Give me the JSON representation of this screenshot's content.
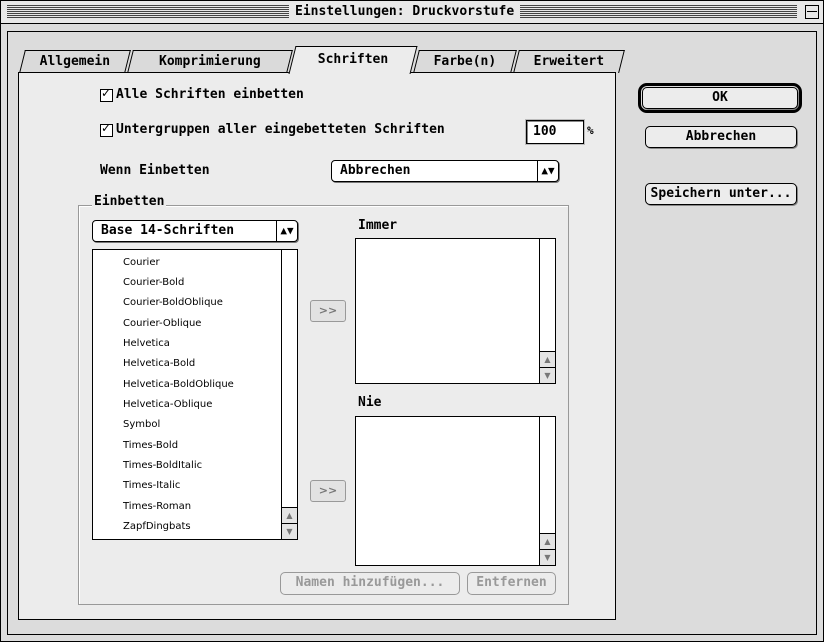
{
  "window": {
    "title": "Einstellungen: Druckvorstufe"
  },
  "tabs": [
    {
      "label": "Allgemein",
      "active": false
    },
    {
      "label": "Komprimierung",
      "active": false
    },
    {
      "label": "Schriften",
      "active": true
    },
    {
      "label": "Farbe(n)",
      "active": false
    },
    {
      "label": "Erweitert",
      "active": false
    }
  ],
  "options": {
    "embed_all": {
      "label": "Alle Schriften einbetten",
      "checked": true
    },
    "subset_all": {
      "label": "Untergruppen aller eingebetteten Schriften",
      "checked": true,
      "value": "100",
      "unit": "%"
    },
    "when_embed": {
      "label": "Wenn Einbetten",
      "value": "Abbrechen"
    }
  },
  "embed_group": {
    "title": "Einbetten",
    "source_popup": "Base 14-Schriften",
    "fonts": [
      "Courier",
      "Courier-Bold",
      "Courier-BoldOblique",
      "Courier-Oblique",
      "Helvetica",
      "Helvetica-Bold",
      "Helvetica-BoldOblique",
      "Helvetica-Oblique",
      "Symbol",
      "Times-Bold",
      "Times-BoldItalic",
      "Times-Italic",
      "Times-Roman",
      "ZapfDingbats"
    ],
    "always_label": "Immer",
    "never_label": "Nie",
    "move_label": ">>",
    "add_names_label": "Namen hinzufügen...",
    "remove_label": "Entfernen"
  },
  "buttons": {
    "ok": "OK",
    "cancel": "Abbrechen",
    "save_as": "Speichern unter..."
  },
  "icons": {
    "checkmark": "check-icon",
    "popup_arrows": "up-down-arrows-icon",
    "scroll_up": "up-arrow-icon",
    "scroll_down": "down-arrow-icon"
  }
}
